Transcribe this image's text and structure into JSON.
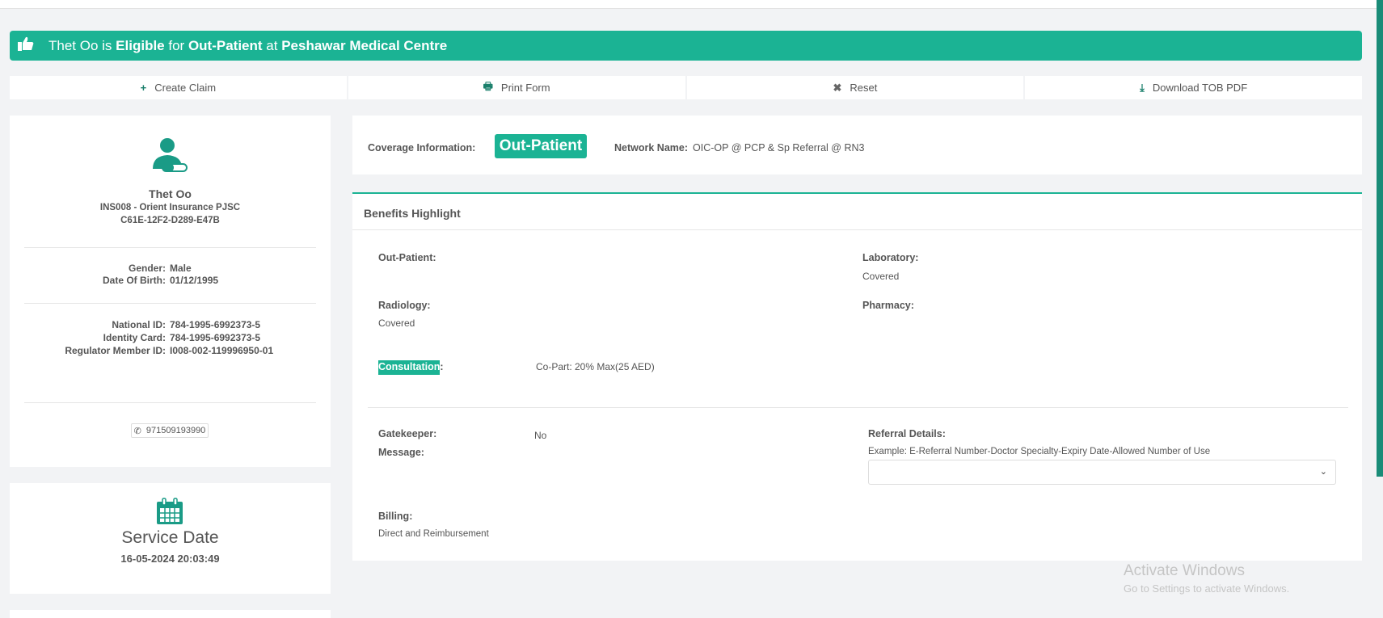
{
  "banner": {
    "icon": "thumbs-up-icon",
    "name": "Thet Oo",
    "is": "is",
    "status": "Eligible",
    "for": "for",
    "coverage": "Out-Patient",
    "at": "at",
    "provider": "Peshawar Medical Centre"
  },
  "actions": [
    {
      "label": "Create Claim",
      "icon": "plus-icon",
      "glyph": "+"
    },
    {
      "label": "Print Form",
      "icon": "print-icon",
      "glyph": "🖶"
    },
    {
      "label": "Reset",
      "icon": "close-icon",
      "glyph": "✖"
    },
    {
      "label": "Download TOB PDF",
      "icon": "download-icon",
      "glyph": "⤓"
    }
  ],
  "member": {
    "name": "Thet Oo",
    "insurer": "INS008 - Orient Insurance PJSC",
    "code": "C61E-12F2-D289-E47B",
    "gender_label": "Gender:",
    "gender": "Male",
    "dob_label": "Date Of Birth:",
    "dob": "01/12/1995",
    "national_id_label": "National ID:",
    "national_id": "784-1995-6992373-5",
    "identity_card_label": "Identity Card:",
    "identity_card": "784-1995-6992373-5",
    "regulator_label": "Regulator Member ID:",
    "regulator_id": "I008-002-119996950-01",
    "phone": "971509193990"
  },
  "service": {
    "title": "Service Date",
    "datetime": "16-05-2024 20:03:49"
  },
  "coverage": {
    "label": "Coverage Information:",
    "type": "Out-Patient",
    "network_label": "Network Name:",
    "network": "OIC-OP @ PCP & Sp Referral @ RN3"
  },
  "benefits": {
    "title": "Benefits Highlight",
    "out_patient": "Out-Patient:",
    "laboratory": "Laboratory:",
    "laboratory_value": "Covered",
    "radiology": "Radiology:",
    "radiology_value": "Covered",
    "pharmacy": "Pharmacy:",
    "consultation": "Consultation",
    "colon": ":",
    "consultation_value": "Co-Part: 20% Max(25 AED)",
    "gatekeeper": "Gatekeeper:",
    "gatekeeper_value": "No",
    "message": "Message:",
    "referral": "Referral Details:",
    "referral_example": "Example: E-Referral Number-Doctor Specialty-Expiry Date-Allowed Number of Use",
    "billing": "Billing:",
    "billing_value": "Direct and Reimbursement"
  },
  "watermark": {
    "line1": "Activate Windows",
    "line2": "Go to Settings to activate Windows."
  },
  "colors": {
    "accent": "#1bb394",
    "icon": "#1a7f6b"
  }
}
